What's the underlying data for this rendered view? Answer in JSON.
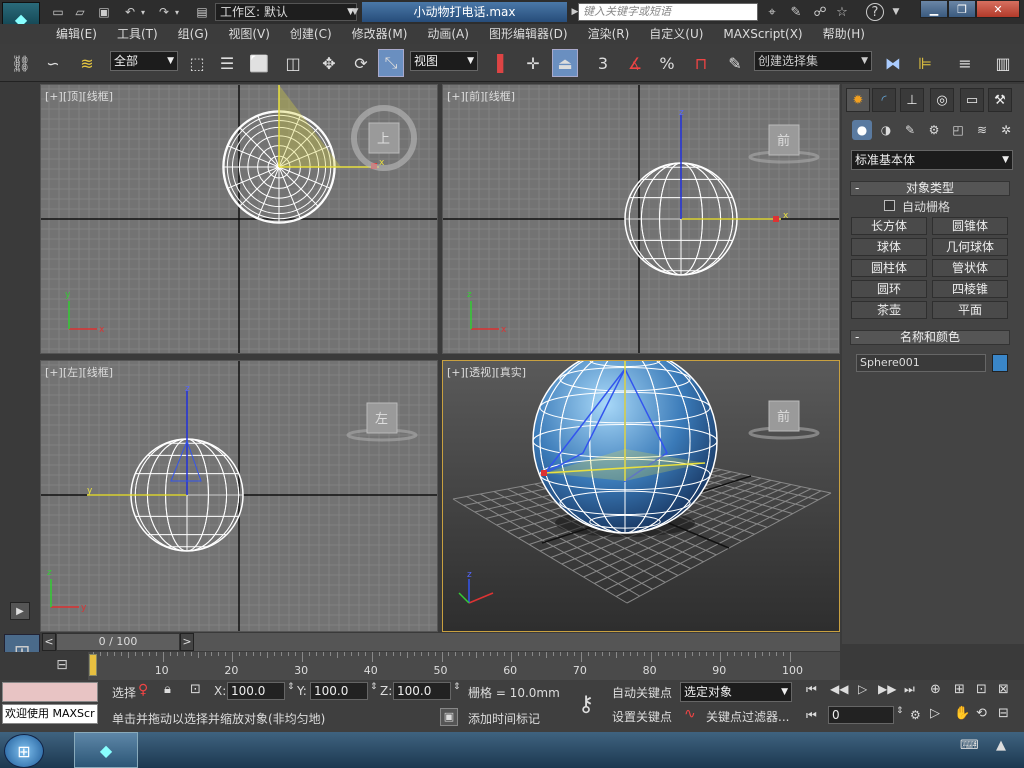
{
  "title_bar": {
    "workspace_label": "工作区: 默认",
    "file_title": "小动物打电话.max",
    "search_placeholder": "键入关键字或短语",
    "help_label": "?"
  },
  "menus": [
    "编辑(E)",
    "工具(T)",
    "组(G)",
    "视图(V)",
    "创建(C)",
    "修改器(M)",
    "动画(A)",
    "图形编辑器(D)",
    "渲染(R)",
    "自定义(U)",
    "MAXScript(X)",
    "帮助(H)"
  ],
  "toolbar": {
    "selection_filter": "全部",
    "ref_coord": "视图",
    "selection_set_placeholder": "创建选择集",
    "snap_label": "3",
    "percent_label": "%"
  },
  "viewports": {
    "top": {
      "label_plus": "[+]",
      "label_view": "[顶]",
      "label_shading": "[线框]",
      "cube_text": "上"
    },
    "front": {
      "label_plus": "[+]",
      "label_view": "[前]",
      "label_shading": "[线框]",
      "cube_text": "前"
    },
    "left": {
      "label_plus": "[+]",
      "label_view": "[左]",
      "label_shading": "[线框]",
      "cube_text": "左"
    },
    "persp": {
      "label_plus": "[+]",
      "label_view": "[透视]",
      "label_shading": "[真实]",
      "cube_text": "前"
    }
  },
  "axis_labels": {
    "x": "x",
    "y": "y",
    "z": "z"
  },
  "command_panel": {
    "category": "标准基本体",
    "object_type_header": "对象类型",
    "auto_grid_label": "自动栅格",
    "object_buttons": [
      "长方体",
      "圆锥体",
      "球体",
      "几何球体",
      "圆柱体",
      "管状体",
      "圆环",
      "四棱锥",
      "茶壶",
      "平面"
    ],
    "name_color_header": "名称和颜色",
    "object_name": "Sphere001",
    "object_color": "#3a86c8"
  },
  "time_slider": {
    "frame_label": "0 / 100",
    "prev": "<",
    "next": ">"
  },
  "track_ticks": [
    "10",
    "20",
    "30",
    "40",
    "50",
    "60",
    "70",
    "80",
    "90",
    "100"
  ],
  "status": {
    "listener_text": "欢迎使用 MAXScr",
    "selection_label": "选择",
    "x_label": "X:",
    "x_value": "100.0",
    "y_label": "Y:",
    "y_value": "100.0",
    "z_label": "Z:",
    "z_value": "100.0",
    "grid_label": "栅格 = 10.0mm",
    "prompt_text": "单击并拖动以选择并缩放对象(非均匀地)",
    "add_time_tag": "添加时间标记",
    "auto_key": "自动关键点",
    "set_key": "设置关键点",
    "key_mode": "选定对象",
    "key_filters": "关键点过滤器...",
    "frame_value": "0"
  }
}
